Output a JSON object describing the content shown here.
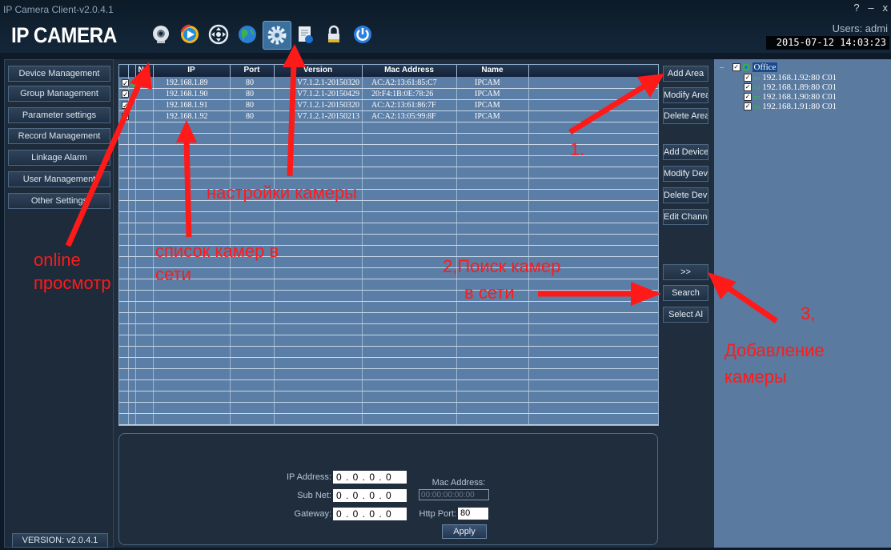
{
  "window": {
    "title": "IP Camera Client-v2.0.4.1",
    "logo": "IP CAMERA",
    "controls": [
      "?",
      "–",
      "x"
    ],
    "users_label": "Users: admi",
    "datetime": "2015-07-12 14:03:23"
  },
  "toolbar": {
    "icons": [
      "webcam-icon",
      "playback-icon",
      "ptz-control-icon",
      "globe-icon",
      "settings-gear-icon",
      "log-document-icon",
      "lock-icon",
      "power-icon"
    ],
    "active": "settings-gear-icon"
  },
  "sidebar": {
    "items": [
      {
        "label": "Device Management"
      },
      {
        "label": "Group Management"
      },
      {
        "label": "Parameter settings"
      },
      {
        "label": "Record Management"
      },
      {
        "label": "Linkage Alarm"
      },
      {
        "label": "User Management"
      },
      {
        "label": "Other Settings"
      }
    ],
    "version": "VERSION: v2.0.4.1"
  },
  "table": {
    "columns": {
      "no": "NO",
      "ip": "IP",
      "port": "Port",
      "version": "Version",
      "mac": "Mac Address",
      "name": "Name"
    },
    "rows": [
      {
        "checked": true,
        "ip": "192.168.1.89",
        "port": "80",
        "version": "V7.1.2.1-20150320",
        "mac": "AC:A2:13:61:85:C7",
        "name": "IPCAM"
      },
      {
        "checked": true,
        "ip": "192.168.1.90",
        "port": "80",
        "version": "V7.1.2.1-20150429",
        "mac": "20:F4:1B:0E:78:26",
        "name": "IPCAM"
      },
      {
        "checked": true,
        "ip": "192.168.1.91",
        "port": "80",
        "version": "V7.1.2.1-20150320",
        "mac": "AC:A2:13:61:86:7F",
        "name": "IPCAM"
      },
      {
        "checked": true,
        "ip": "192.168.1.92",
        "port": "80",
        "version": "V7.1.2.1-20150213",
        "mac": "AC:A2:13:05:99:8F",
        "name": "IPCAM"
      }
    ]
  },
  "buttons": {
    "add_area": "Add Area",
    "modify_area": "Modify Area",
    "delete_area": "Delete Area",
    "add_device": "Add Device",
    "modify_device": "Modify Devic",
    "delete_device": "Delete Devic",
    "edit_channel": "Edit Channe",
    "move": ">>",
    "search": "Search",
    "select_all": "Select Al"
  },
  "tree": {
    "root": "Office",
    "devices": [
      "192.168.1.92:80 C01",
      "192.168.1.89:80 C01",
      "192.168.1.90:80 C01",
      "192.168.1.91:80 C01"
    ]
  },
  "network": {
    "ip_label": "IP Address:",
    "ip_value": "0 . 0 . 0 . 0",
    "subnet_label": "Sub Net:",
    "subnet_value": "0 . 0 . 0 . 0",
    "gateway_label": "Gateway:",
    "gateway_value": "0 . 0 . 0 . 0",
    "mac_label": "Mac Address:",
    "mac_value": "00:00:00:00:00",
    "http_port_label": "Http Port:",
    "http_port_value": "80",
    "apply": "Apply"
  },
  "annotations": {
    "online_1": "online",
    "online_2": "просмотр",
    "list_1": "список камер в",
    "list_2": "сети",
    "settings": "настройки камеры",
    "step1": "1.",
    "search_1": "2,Поиск камер",
    "search_2": "в сети",
    "step3": "3,",
    "add_1": "Добавление",
    "add_2": "камеры",
    "color": "#ff1a1a"
  }
}
